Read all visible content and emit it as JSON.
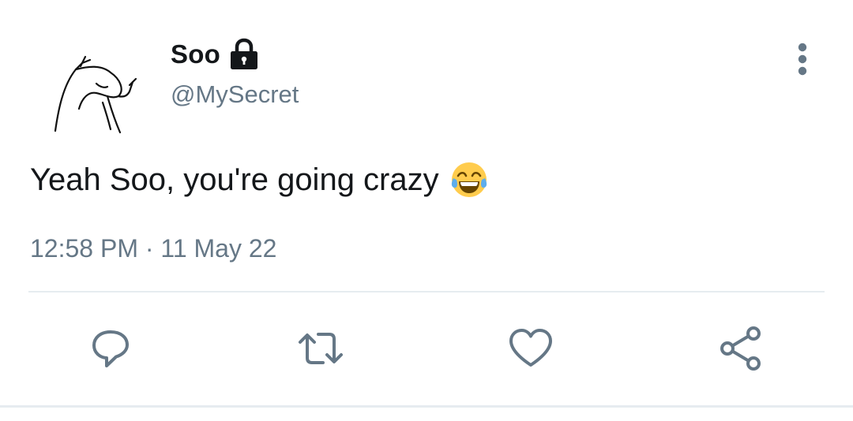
{
  "tweet": {
    "author": {
      "display_name": "Soo",
      "handle": "@MySecret",
      "protected_icon": "lock-icon",
      "avatar_icon": "sketch-avatar"
    },
    "text": "Yeah Soo, you're going crazy",
    "emoji": "face-with-tears-of-joy",
    "timestamp": "12:58 PM · 11 May 22"
  },
  "actions": [
    {
      "name": "reply",
      "icon": "comment-icon"
    },
    {
      "name": "retweet",
      "icon": "retweet-icon"
    },
    {
      "name": "like",
      "icon": "heart-icon"
    },
    {
      "name": "share",
      "icon": "share-icon"
    }
  ],
  "colors": {
    "text_primary": "#14171a",
    "text_secondary": "#657786",
    "icon_gray": "#657786",
    "divider": "#e6ecf0",
    "emoji_yellow": "#ffcc4d",
    "emoji_tear": "#5dadec"
  }
}
